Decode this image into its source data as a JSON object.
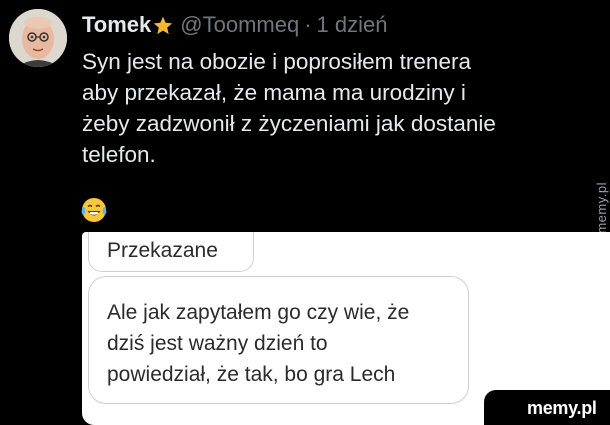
{
  "tweet": {
    "author_name": "Tomek",
    "author_badge_icon": "star-icon",
    "handle": "@Toommeq",
    "separator": "·",
    "time": "1 dzień",
    "text_lines": [
      "Syn jest na obozie i poprosiłem trenera",
      "aby przekazał, że mama ma urodziny i",
      "żeby zadzwonił z życzeniami jak dostanie",
      "telefon."
    ],
    "emoji_icon": "face-with-tears-of-joy-icon"
  },
  "screenshot": {
    "top_bubble_text": "Przekazane",
    "message_lines": [
      "Ale jak zapytałem go czy wie, że",
      "dziś jest ważny dzień to",
      "powiedział, że tak, bo gra Lech"
    ]
  },
  "watermarks": {
    "side": "memy.pl",
    "corner": "memy.pl"
  },
  "colors": {
    "background": "#000000",
    "text_primary": "#e7e9ea",
    "text_secondary": "#71767b",
    "star": "#f5b82e",
    "card_background": "#ffffff",
    "card_text": "#2b2b2b"
  }
}
